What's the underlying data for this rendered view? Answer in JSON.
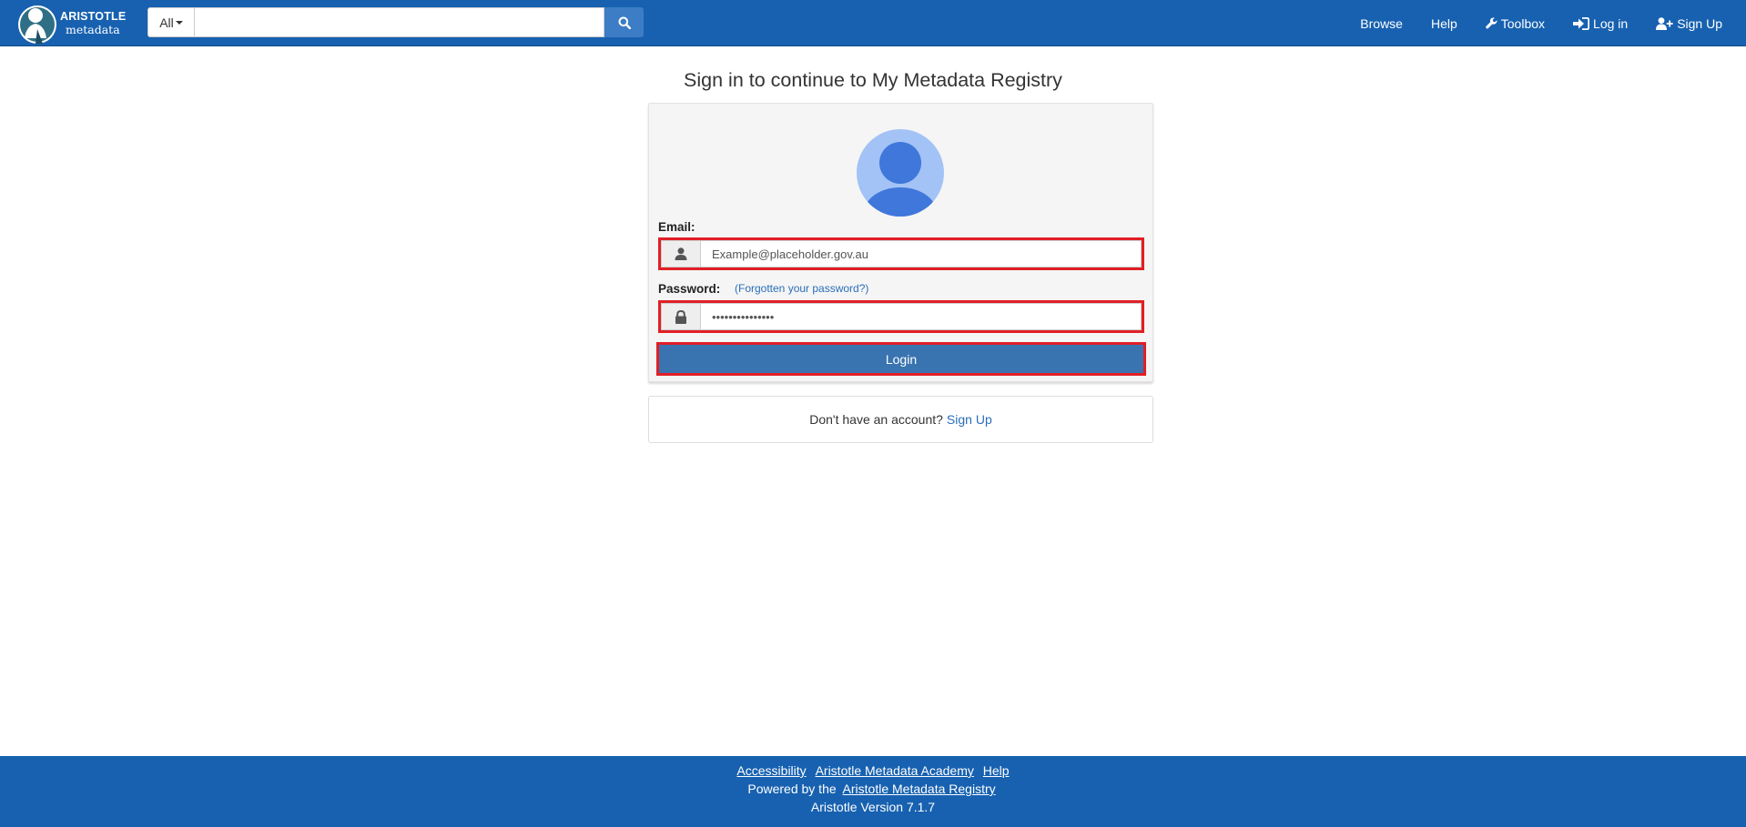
{
  "navbar": {
    "brand_top": "ARISTOTLE",
    "brand_bottom": "metadata",
    "search_scope": "All",
    "search_value": "",
    "links": {
      "browse": "Browse",
      "help": "Help",
      "toolbox": "Toolbox",
      "login": "Log in",
      "signup": "Sign Up"
    }
  },
  "main": {
    "title": "Sign in to continue to My Metadata Registry",
    "email_label": "Email:",
    "email_value": "Example@placeholder.gov.au",
    "password_label": "Password:",
    "forgot_link": "(Forgotten your password?)",
    "password_value": "•••••••••••••••",
    "login_button": "Login",
    "signup_prompt": "Don't have an account?",
    "signup_link": "Sign Up"
  },
  "footer": {
    "links": [
      "Accessibility",
      "Aristotle Metadata Academy",
      "Help"
    ],
    "powered_by": "Powered by the",
    "registry_link": "Aristotle Metadata Registry",
    "version": "Aristotle Version 7.1.7"
  },
  "colors": {
    "navbar_bg": "#1761b0",
    "button_bg": "#3974b1",
    "highlight_border": "#e11f26",
    "link": "#2a6eb9",
    "avatar_light": "#a3c2f5",
    "avatar_dark": "#3f77db"
  },
  "icons": {
    "search": "search-icon",
    "toolbox": "wrench-icon",
    "login": "sign-in-icon",
    "signup": "user-plus-icon",
    "email_addon": "user-icon",
    "password_addon": "lock-icon",
    "avatar": "avatar-icon",
    "logo": "aristotle-logo"
  }
}
